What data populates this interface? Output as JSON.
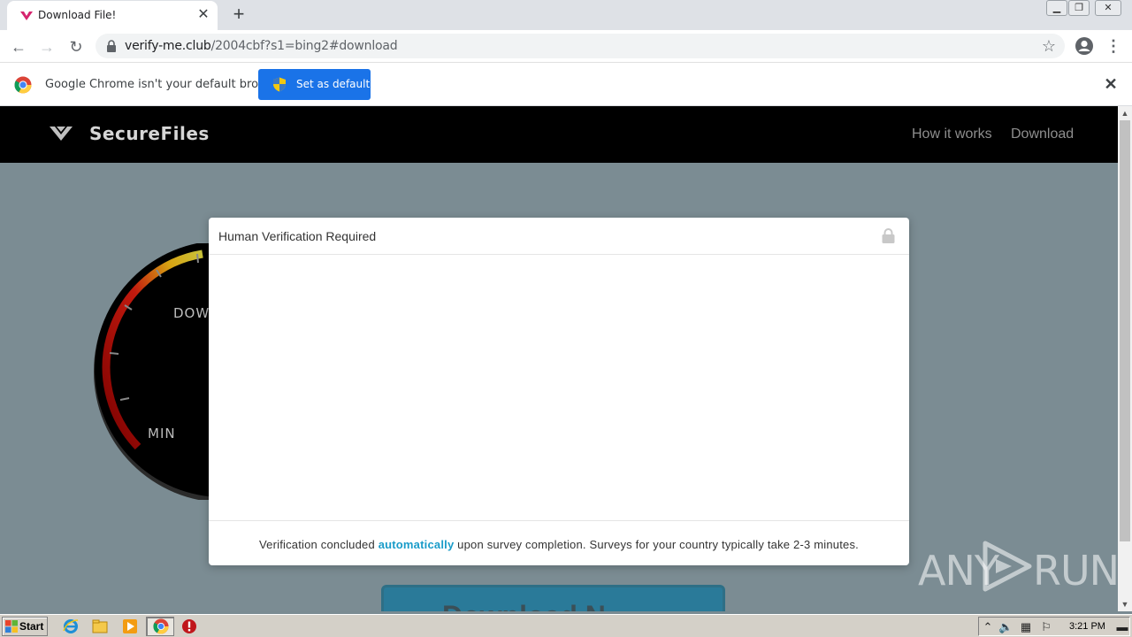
{
  "browser": {
    "tab": {
      "title": "Download File!"
    },
    "address": {
      "host": "verify-me.club",
      "path": "/2004cbf?s1=bing2#download"
    },
    "infobar": {
      "message": "Google Chrome isn't your default browser",
      "button_label": "Set as default"
    }
  },
  "site": {
    "brand": "SecureFiles",
    "nav": [
      "How it works",
      "Download"
    ],
    "gauge": {
      "labels": [
        "DOWN",
        "MIN"
      ]
    },
    "download_button_label": "Download N"
  },
  "modal": {
    "title": "Human Verification Required",
    "footer_before": "Verification concluded ",
    "footer_highlight": "automatically",
    "footer_after": " upon survey completion. Surveys for your country typically take 2-3 minutes."
  },
  "watermark": {
    "left": "ANY",
    "right": "RUN"
  },
  "taskbar": {
    "start_label": "Start",
    "clock": "3:21 PM"
  },
  "colors": {
    "accent_blue": "#1a73e8",
    "highlight": "#1a9cc9",
    "nav_bg": "#000000"
  }
}
